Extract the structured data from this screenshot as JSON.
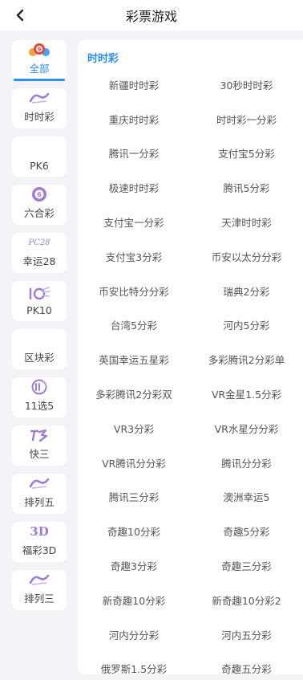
{
  "header": {
    "title": "彩票游戏",
    "back_icon": "chevron-left-icon"
  },
  "sidebar": {
    "items": [
      {
        "label": "全部",
        "icon": "lottery-balls-icon",
        "active": true
      },
      {
        "label": "时时彩",
        "icon": "shishicai-logo-icon",
        "active": false
      },
      {
        "label": "PK6",
        "icon": "",
        "active": false
      },
      {
        "label": "六合彩",
        "icon": "mark-six-icon",
        "active": false
      },
      {
        "label": "幸运28",
        "icon": "pc28-icon",
        "active": false,
        "badge": "PC28"
      },
      {
        "label": "PK10",
        "icon": "pk10-icon",
        "active": false
      },
      {
        "label": "区块彩",
        "icon": "",
        "active": false
      },
      {
        "label": "11选5",
        "icon": "eleven-five-icon",
        "active": false
      },
      {
        "label": "快三",
        "icon": "kuaisan-icon",
        "active": false
      },
      {
        "label": "排列五",
        "icon": "pailiewu-logo-icon",
        "active": false
      },
      {
        "label": "福彩3D",
        "icon": "fucai-3d-icon",
        "active": false,
        "badge": "3D"
      },
      {
        "label": "排列三",
        "icon": "pailiesan-logo-icon",
        "active": false
      }
    ]
  },
  "panel": {
    "section_title": "时时彩",
    "games": [
      "新疆时时彩",
      "30秒时时彩",
      "重庆时时彩",
      "时时彩一分彩",
      "腾讯一分彩",
      "支付宝5分彩",
      "极速时时彩",
      "腾讯5分彩",
      "支付宝一分彩",
      "天津时时彩",
      "支付宝3分彩",
      "币安以太分分彩",
      "币安比特分分彩",
      "瑞典2分彩",
      "台湾5分彩",
      "河内5分彩",
      "英国幸运五星彩",
      "多彩腾讯2分彩单",
      "多彩腾讯2分彩双",
      "VR金星1.5分彩",
      "VR3分彩",
      "VR水星分分彩",
      "VR腾讯分分彩",
      "腾讯分分彩",
      "腾讯三分彩",
      "澳洲幸运5",
      "奇趣10分彩",
      "奇趣5分彩",
      "奇趣3分彩",
      "奇趣三分彩",
      "新奇趣10分彩",
      "新奇趣10分彩2",
      "河内分分彩",
      "河内五分彩",
      "俄罗斯1.5分彩",
      "奇趣五分彩"
    ]
  },
  "colors": {
    "accent": "#2b8ff0",
    "icon_purple": "#a07cd6",
    "background": "#f4f4f8"
  }
}
